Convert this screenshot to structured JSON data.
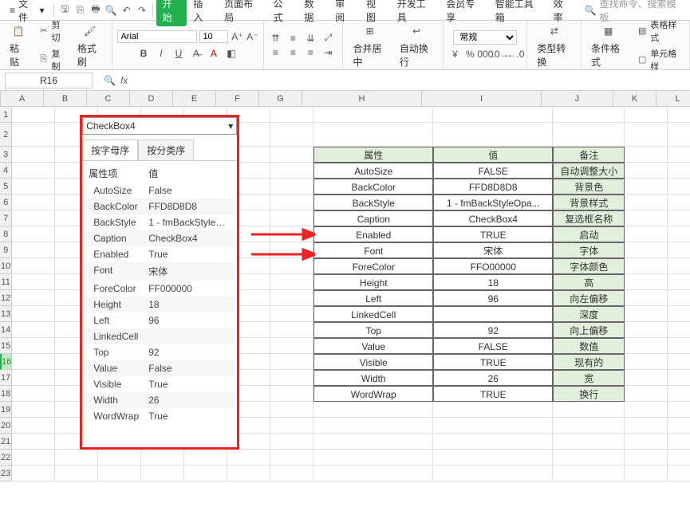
{
  "menubar": {
    "file": "文件",
    "tabs": [
      "开始",
      "插入",
      "页面布局",
      "公式",
      "数据",
      "审阅",
      "视图",
      "开发工具",
      "会员专享",
      "智能工具箱",
      "效率"
    ],
    "active_tab": 0,
    "search_placeholder": "查找命令、搜索模板"
  },
  "ribbon": {
    "paste": "粘贴",
    "cut": "剪切",
    "copy": "复制",
    "format_painter": "格式刷",
    "font_name": "Arial",
    "font_size": "10",
    "merge": "合并居中",
    "wrap": "自动换行",
    "number_format": "常规",
    "type_convert": "类型转换",
    "cond_format": "条件格式",
    "table_style": "表格样式",
    "cell_style": "单元格样"
  },
  "formula": {
    "name_box": "R16"
  },
  "columns": [
    "A",
    "B",
    "C",
    "D",
    "E",
    "F",
    "G",
    "H",
    "I",
    "J",
    "K",
    "L"
  ],
  "rows": [
    1,
    2,
    3,
    4,
    5,
    6,
    7,
    8,
    9,
    10,
    11,
    12,
    13,
    14,
    15,
    16,
    17,
    18,
    19,
    20,
    21,
    22,
    23
  ],
  "sel_row": 16,
  "panel": {
    "object": "CheckBox4",
    "tabs": [
      "按字母序",
      "按分类序"
    ],
    "head_name": "属性项",
    "head_val": "值",
    "props": [
      {
        "n": "AutoSize",
        "v": "False"
      },
      {
        "n": "BackColor",
        "v": "FFD8D8D8"
      },
      {
        "n": "BackStyle",
        "v": "1 - fmBackStyleOpa..."
      },
      {
        "n": "Caption",
        "v": "CheckBox4"
      },
      {
        "n": "Enabled",
        "v": "True"
      },
      {
        "n": "Font",
        "v": "宋体"
      },
      {
        "n": "ForeColor",
        "v": "FF000000"
      },
      {
        "n": "Height",
        "v": "18"
      },
      {
        "n": "Left",
        "v": "96"
      },
      {
        "n": "LinkedCell",
        "v": ""
      },
      {
        "n": "Top",
        "v": "92"
      },
      {
        "n": "Value",
        "v": "False"
      },
      {
        "n": "Visible",
        "v": "True"
      },
      {
        "n": "Width",
        "v": "26"
      },
      {
        "n": "WordWrap",
        "v": "True"
      }
    ]
  },
  "table": {
    "head": {
      "h": "属性",
      "i": "值",
      "j": "备注"
    },
    "rows": [
      {
        "h": "AutoSize",
        "i": "FALSE",
        "j": "自动调整大小"
      },
      {
        "h": "BackColor",
        "i": "FFD8D8D8",
        "j": "背景色"
      },
      {
        "h": "BackStyle",
        "i": "1 - fmBackStyleOpa...",
        "j": "背景样式"
      },
      {
        "h": "Caption",
        "i": "CheckBox4",
        "j": "复选框名称"
      },
      {
        "h": "Enabled",
        "i": "TRUE",
        "j": "启动"
      },
      {
        "h": "Font",
        "i": "宋体",
        "j": "字体"
      },
      {
        "h": "ForeColor",
        "i": "FFO00000",
        "j": "字体颜色"
      },
      {
        "h": "Height",
        "i": "18",
        "j": "高"
      },
      {
        "h": "Left",
        "i": "96",
        "j": "向左偏移"
      },
      {
        "h": "LinkedCell",
        "i": "",
        "j": "深度"
      },
      {
        "h": "Top",
        "i": "92",
        "j": "向上偏移"
      },
      {
        "h": "Value",
        "i": "FALSE",
        "j": "数值"
      },
      {
        "h": "Visible",
        "i": "TRUE",
        "j": "现有的"
      },
      {
        "h": "Width",
        "i": "26",
        "j": "宽"
      },
      {
        "h": "WordWrap",
        "i": "TRUE",
        "j": "换行"
      }
    ]
  }
}
